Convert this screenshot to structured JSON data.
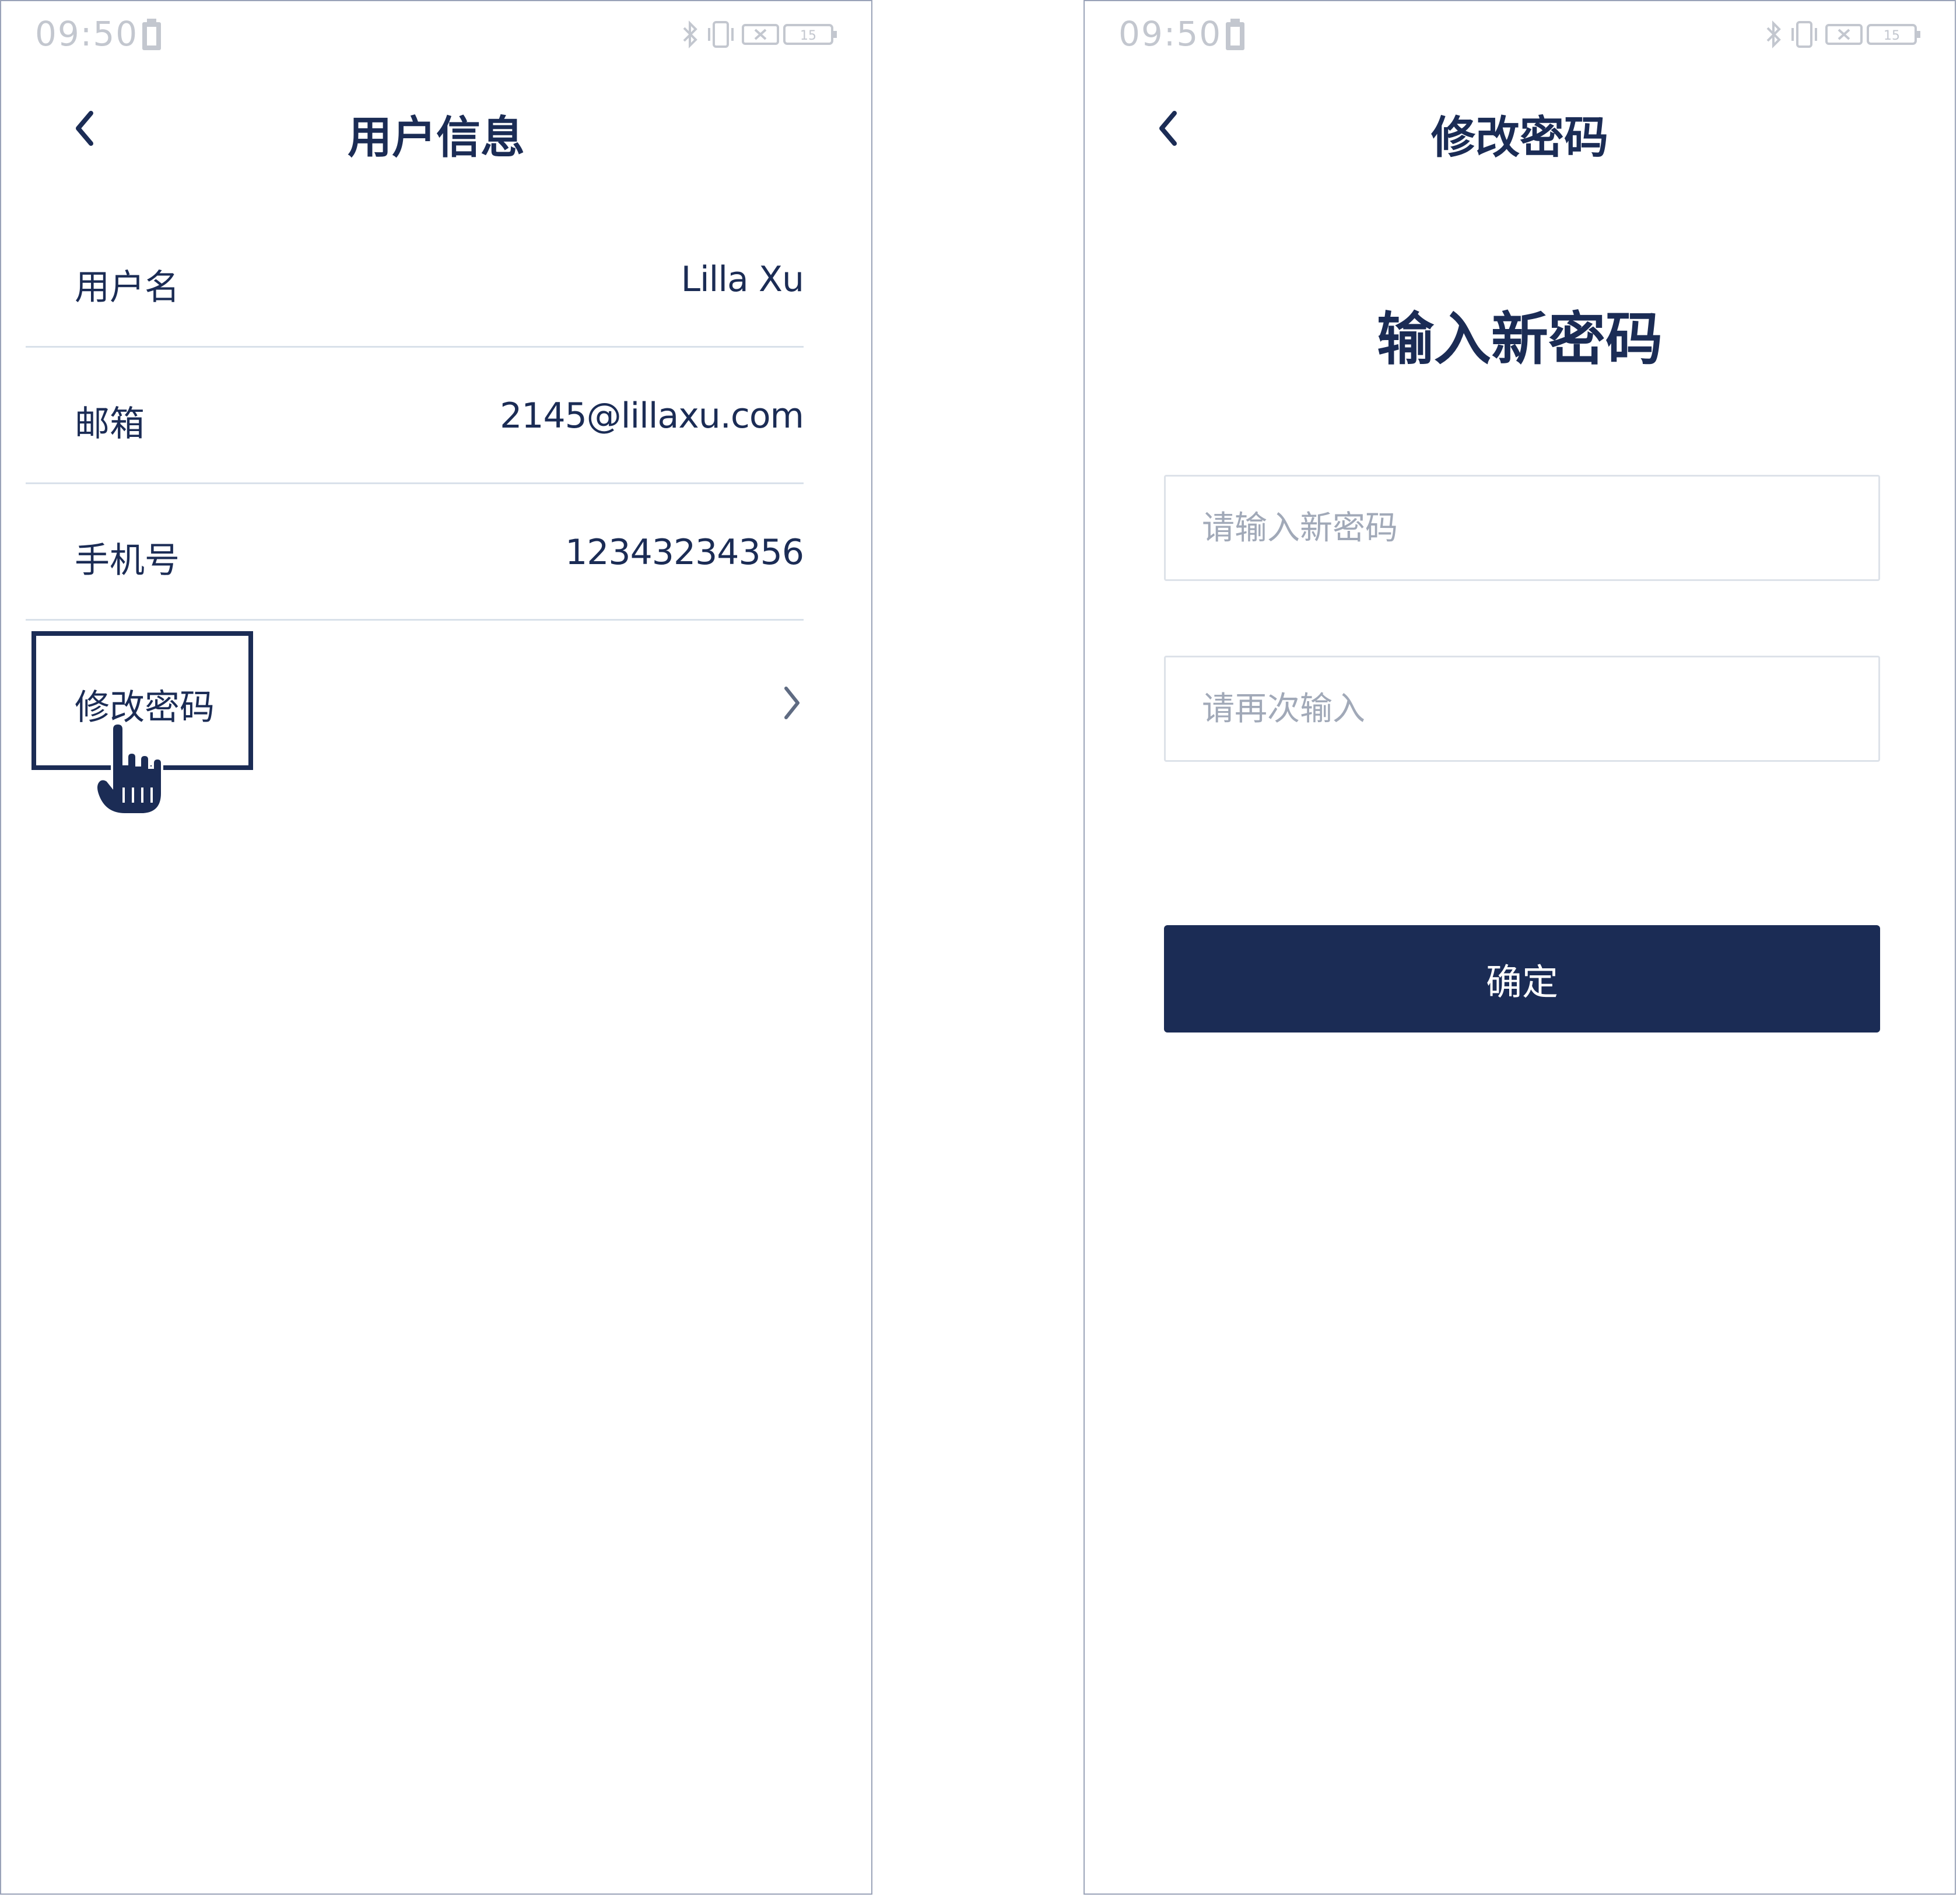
{
  "colors": {
    "primary": "#1b2c55",
    "divider": "#d9e1ea",
    "status_gray": "#c3c7cf",
    "placeholder": "#a1a9b8",
    "background": "#ffffff"
  },
  "left_screen": {
    "status_bar": {
      "time": "09:50",
      "battery": "15"
    },
    "nav": {
      "back_icon": "chevron-left-icon",
      "title": "用户信息"
    },
    "rows": [
      {
        "label": "用户名",
        "value": "Lilla Xu"
      },
      {
        "label": "邮箱",
        "value": "2145@lillaxu.com"
      },
      {
        "label": "手机号",
        "value": "12343234356"
      }
    ],
    "change_password": {
      "label": "修改密码",
      "icon": "chevron-right-icon"
    },
    "cursor_icon": "hand-pointer-icon"
  },
  "right_screen": {
    "status_bar": {
      "time": "09:50",
      "battery": "15"
    },
    "nav": {
      "back_icon": "chevron-left-icon",
      "title": "修改密码"
    },
    "heading": "输入新密码",
    "new_password_placeholder": "请输入新密码",
    "repeat_password_placeholder": "请再次输入",
    "confirm_label": "确定"
  }
}
